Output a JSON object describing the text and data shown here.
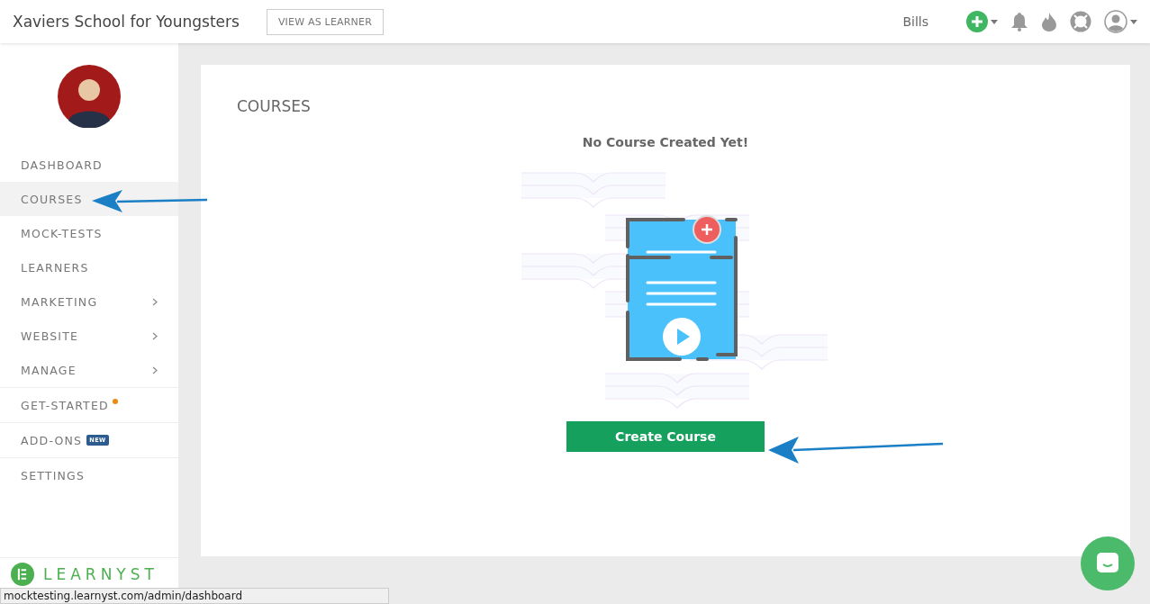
{
  "header": {
    "school_name": "Xaviers School for Youngsters",
    "view_button": "VIEW AS LEARNER",
    "user_menu": "Bills"
  },
  "sidebar": {
    "sections": [
      {
        "items": [
          {
            "label": "DASHBOARD",
            "selected": false,
            "has_submenu": false,
            "dot": false
          },
          {
            "label": "COURSES",
            "selected": true,
            "has_submenu": false,
            "dot": false
          },
          {
            "label": "MOCK-TESTS",
            "selected": false,
            "has_submenu": false,
            "dot": false
          },
          {
            "label": "LEARNERS",
            "selected": false,
            "has_submenu": false,
            "dot": false
          },
          {
            "label": "MARKETING",
            "selected": false,
            "has_submenu": true,
            "dot": false
          },
          {
            "label": "WEBSITE",
            "selected": false,
            "has_submenu": true,
            "dot": false
          },
          {
            "label": "MANAGE",
            "selected": false,
            "has_submenu": true,
            "dot": false
          }
        ]
      },
      {
        "items": [
          {
            "label": "GET-STARTED",
            "selected": false,
            "has_submenu": false,
            "dot": true
          },
          {
            "label": "ADD-ONS",
            "selected": false,
            "has_submenu": false,
            "dot": false,
            "badge": "NEW"
          },
          {
            "label": "SETTINGS",
            "selected": false,
            "has_submenu": false,
            "dot": false
          }
        ]
      }
    ],
    "logo_text": "LEARNYST"
  },
  "main": {
    "title": "COURSES",
    "empty_message": "No Course Created Yet!",
    "create_button": "Create Course"
  },
  "status_bar": {
    "url": "mocktesting.learnyst.com/admin/dashboard"
  }
}
